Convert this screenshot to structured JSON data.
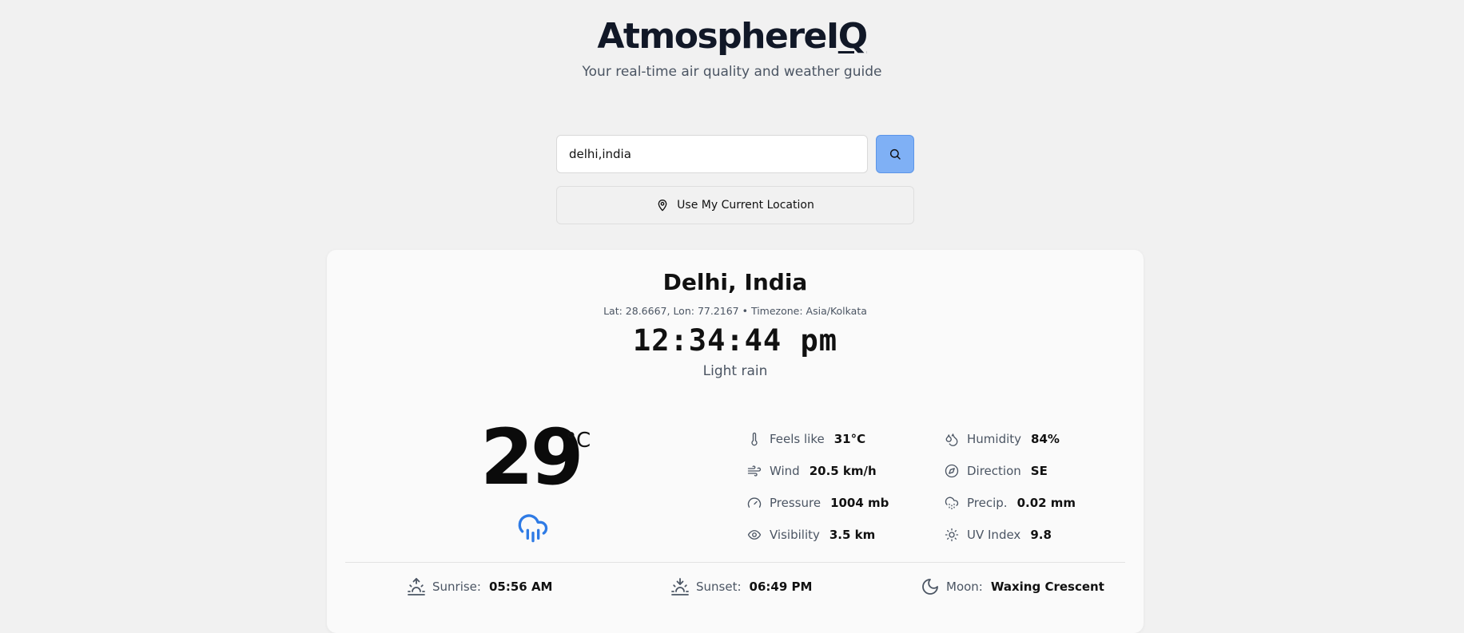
{
  "app": {
    "title_main": "AtmosphereI",
    "title_q": "Q",
    "tagline": "Your real-time air quality and weather guide"
  },
  "search": {
    "value": "delhi,india",
    "placeholder": "",
    "button_icon": "search-icon",
    "location_label": "Use My Current Location",
    "location_icon": "map-pin-icon"
  },
  "location": {
    "name": "Delhi, India",
    "coords": "Lat: 28.6667, Lon: 77.2167 • Timezone: Asia/Kolkata",
    "time": "12:34:44 pm",
    "condition": "Light rain"
  },
  "current": {
    "temperature": "29",
    "unit": "°C",
    "icon": "cloud-rain-icon",
    "icon_color": "#2f7be5"
  },
  "stats": [
    {
      "id": "feels-like",
      "icon": "thermometer-icon",
      "label": "Feels like",
      "value": "31°C"
    },
    {
      "id": "humidity",
      "icon": "droplets-icon",
      "label": "Humidity",
      "value": "84%"
    },
    {
      "id": "wind",
      "icon": "wind-icon",
      "label": "Wind",
      "value": "20.5 km/h"
    },
    {
      "id": "direction",
      "icon": "compass-icon",
      "label": "Direction",
      "value": "SE"
    },
    {
      "id": "pressure",
      "icon": "gauge-icon",
      "label": "Pressure",
      "value": "1004 mb"
    },
    {
      "id": "precip",
      "icon": "cloud-drizzle-icon",
      "label": "Precip.",
      "value": "0.02 mm"
    },
    {
      "id": "visibility",
      "icon": "eye-icon",
      "label": "Visibility",
      "value": "3.5 km"
    },
    {
      "id": "uv-index",
      "icon": "sun-icon",
      "label": "UV Index",
      "value": "9.8"
    }
  ],
  "astro": {
    "sunrise": {
      "label": "Sunrise:",
      "value": "05:56 AM",
      "icon": "sunrise-icon"
    },
    "sunset": {
      "label": "Sunset:",
      "value": "06:49 PM",
      "icon": "sunset-icon"
    },
    "moon": {
      "label": "Moon:",
      "value": "Waxing Crescent",
      "icon": "moon-icon"
    }
  }
}
